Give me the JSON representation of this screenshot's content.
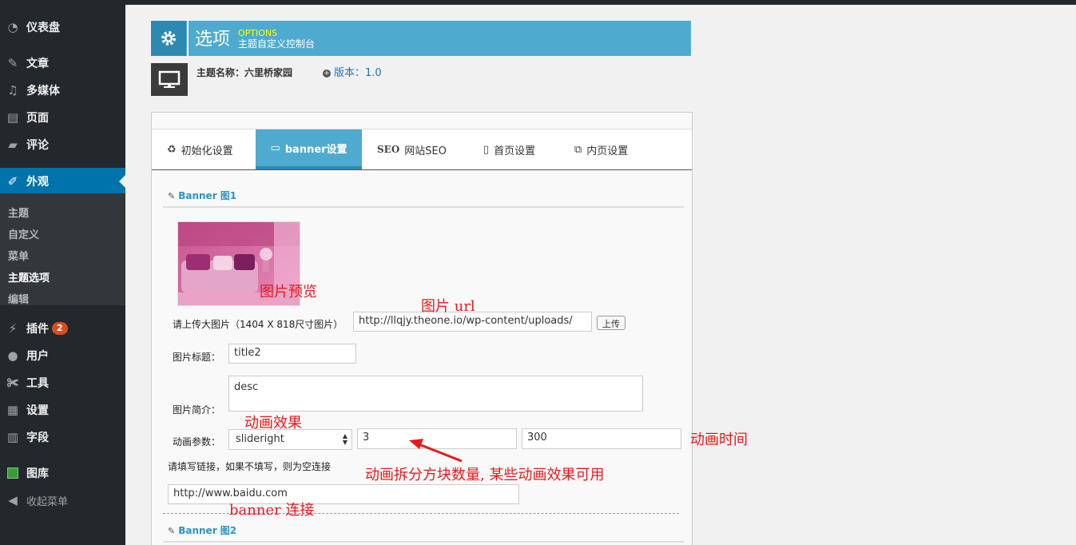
{
  "sidebar": {
    "items": [
      {
        "label": "仪表盘",
        "icon": "dashboard-icon"
      },
      {
        "label": "文章",
        "icon": "pin-icon"
      },
      {
        "label": "多媒体",
        "icon": "media-icon"
      },
      {
        "label": "页面",
        "icon": "page-icon"
      },
      {
        "label": "评论",
        "icon": "comment-icon"
      },
      {
        "label": "外观",
        "icon": "brush-icon"
      },
      {
        "label": "插件",
        "icon": "plugin-icon",
        "badge": "2"
      },
      {
        "label": "用户",
        "icon": "user-icon"
      },
      {
        "label": "工具",
        "icon": "wrench-icon"
      },
      {
        "label": "设置",
        "icon": "settings-icon"
      },
      {
        "label": "字段",
        "icon": "fields-icon"
      },
      {
        "label": "图库",
        "icon": "gallery-icon"
      },
      {
        "label": "收起菜单",
        "icon": "collapse-icon"
      }
    ],
    "submenu": [
      "主题",
      "自定义",
      "菜单",
      "主题选项",
      "编辑"
    ]
  },
  "header": {
    "title": "选项",
    "sub_en": "OPTIONS",
    "sub_cn": "主题自定义控制台"
  },
  "theme": {
    "name_label": "主题名称：六里桥家园",
    "version": "版本：1.0"
  },
  "tabs": [
    {
      "label": "初始化设置",
      "icon": "recycle-icon"
    },
    {
      "label": "banner设置",
      "icon": "monitor-icon"
    },
    {
      "label": "网站SEO",
      "icon": "seo-icon",
      "prefix": "SEO"
    },
    {
      "label": "首页设置",
      "icon": "file-icon"
    },
    {
      "label": "内页设置",
      "icon": "copy-icon"
    }
  ],
  "banner1": {
    "title": "Banner 图1",
    "upload_label": "请上传大图片（1404 X 818尺寸图片）",
    "url_value": "http://llqjy.theone.io/wp-content/uploads/",
    "upload_button": "上传",
    "title_label": "图片标题：",
    "title_value": "title2",
    "desc_label": "图片简介：",
    "desc_value": "desc",
    "anim_label": "动画参数：",
    "anim_select": "slideright",
    "anim_blocks": "3",
    "anim_time": "300",
    "link_hint": "请填写链接，如果不填写，则为空连接",
    "link_value": "http://www.baidu.com"
  },
  "banner2": {
    "title": "Banner 图2"
  },
  "annotations": {
    "preview": "图片预览",
    "url": "图片 url",
    "effect": "动画效果",
    "time": "动画时间",
    "blocks": "动画拆分方块数量, 某些动画效果可用",
    "link": "banner 连接"
  },
  "colors": {
    "sidebar_bg": "#23282d",
    "active_menu": "#0073aa",
    "header_bg": "#4eabcf",
    "annotation": "#e8191d"
  }
}
